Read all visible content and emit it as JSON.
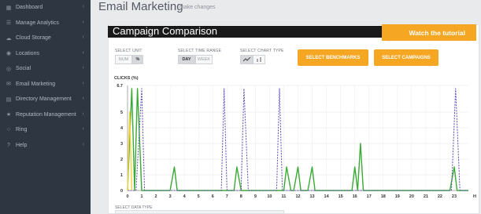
{
  "sidebar": {
    "items": [
      {
        "label": "Dashboard",
        "icon": "dashboard-icon"
      },
      {
        "label": "Manage Analytics",
        "icon": "analytics-icon"
      },
      {
        "label": "Cloud Storage",
        "icon": "cloud-icon"
      },
      {
        "label": "Locations",
        "icon": "location-icon"
      },
      {
        "label": "Social",
        "icon": "social-icon"
      },
      {
        "label": "Email Marketing",
        "icon": "email-icon"
      },
      {
        "label": "Directory Management",
        "icon": "directory-icon"
      },
      {
        "label": "Reputation Management",
        "icon": "reputation-icon"
      },
      {
        "label": "Ring",
        "icon": "ring-icon"
      },
      {
        "label": "Help",
        "icon": "help-icon"
      }
    ]
  },
  "header": {
    "title": "Email Marketing",
    "subtitle": "make changes"
  },
  "panel": {
    "title": "Campaign Comparison",
    "tutorial_label": "Watch the tutorial"
  },
  "controls": {
    "unit": {
      "label": "SELECT UNIT",
      "options": [
        "NUM",
        "%"
      ],
      "selected": "%"
    },
    "time_range": {
      "label": "SELECT TIME RANGE",
      "options": [
        "DAY",
        "WEEK"
      ],
      "selected": "DAY"
    },
    "chart_type": {
      "label": "SELECT CHART TYPE",
      "options": [
        "line-chart-icon",
        "bar-chart-icon"
      ],
      "selected": "line-chart-icon"
    },
    "benchmarks_label": "SELECT BENCHMARKS",
    "campaigns_label": "SELECT CAMPAIGNS"
  },
  "data_type_label": "SELECT DATA TYPE",
  "colors": {
    "sidebar_bg": "#2e3642",
    "accent": "#f5a623",
    "green_series": "#3aaa35",
    "purple_series": "#5b4fb3"
  },
  "chart_data": {
    "type": "line",
    "ylabel": "CLICKS (%)",
    "x_unit_label": "Hr",
    "y_tick_labels": [
      "0",
      "1",
      "2",
      "3",
      "4",
      "5",
      "6.7"
    ],
    "x_ticks": [
      0,
      1,
      2,
      3,
      4,
      5,
      6,
      7,
      8,
      9,
      10,
      11,
      12,
      13,
      14,
      15,
      16,
      17,
      18,
      19,
      20,
      21,
      22,
      23
    ],
    "ylim": [
      0,
      6.7
    ],
    "xlim": [
      0,
      24
    ],
    "grid": true,
    "series": [
      {
        "color": "#3aaa35",
        "style": "solid",
        "x": [
          0,
          0.3,
          0.5,
          0.7,
          1.0,
          1.5,
          2.0,
          3.0,
          3.3,
          3.5,
          3.7,
          4.5,
          7.5,
          7.7,
          8.0,
          11.0,
          11.2,
          11.5,
          11.7,
          12.0,
          12.2,
          12.5,
          12.7,
          13.0,
          13.2,
          13.5,
          15.8,
          16.0,
          16.2,
          16.4,
          16.6,
          16.8,
          22.7,
          23.0,
          23.2,
          24.0
        ],
        "y": [
          0,
          6.5,
          0,
          6.5,
          0,
          0,
          0,
          0,
          1.5,
          0,
          0,
          0,
          0,
          1.5,
          0,
          0,
          1.5,
          0,
          0,
          1.5,
          0,
          0,
          0,
          1.5,
          0,
          0,
          0,
          1.5,
          0,
          3.0,
          0,
          0,
          0,
          1.5,
          0,
          0
        ]
      },
      {
        "color": "#5b4fb3",
        "style": "dashed",
        "x": [
          0,
          0.6,
          1.0,
          1.2,
          1.5,
          2.0,
          6.6,
          6.8,
          7.0,
          7.5,
          8.0,
          8.2,
          8.5,
          10.5,
          10.7,
          10.9,
          11.1,
          22.8,
          23.1,
          23.4,
          24.0
        ],
        "y": [
          0,
          0,
          6.5,
          0,
          0,
          0,
          0,
          6.5,
          0,
          0,
          0,
          6.5,
          0,
          0,
          6.5,
          0,
          0,
          0,
          6.5,
          0,
          0
        ]
      },
      {
        "color": "#f2d23a",
        "style": "solid",
        "x": [
          0,
          0.15,
          0.3
        ],
        "y": [
          0,
          5.0,
          0
        ]
      }
    ]
  }
}
